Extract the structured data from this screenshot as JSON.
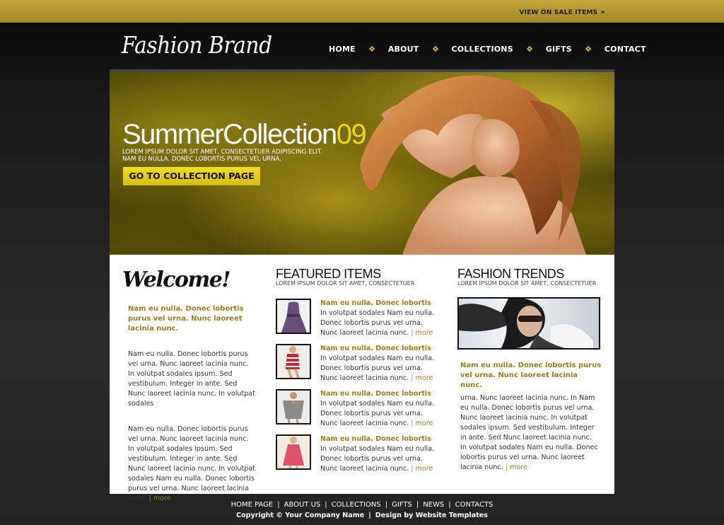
{
  "topbar": {
    "sale_label": "VIEW ON SALE ITEMS"
  },
  "header": {
    "logo": "Fashion Brand",
    "nav": [
      "HOME",
      "ABOUT",
      "COLLECTIONS",
      "GIFTS",
      "CONTACT"
    ]
  },
  "hero": {
    "title_main": "SummerCollection",
    "title_year": "09",
    "text": "LOREM IPSUM DOLOR SIT AMET, CONSECTETUER ADIPISCING ELIT. NAM EU NULLA. DONEC LOBORTIS PURUS VEL URNA.",
    "button": "GO TO COLLECTION PAGE"
  },
  "welcome": {
    "title": "Welcome!",
    "lead": "Nam eu nulla. Donec lobortis purus vel urna. Nunc laoreet lacinia nunc.",
    "para1": "Nam eu nulla. Donec lobortis purus vel urna. Nunc laoreet lacinia nunc. In volutpat sodales ipsum. Sed vestibulum. Integer in ante. Sed Nunc laoreet lacinia nunc. In volutpat sodales",
    "para2": "Nam eu nulla. Donec lobortis purus vel urna. Nunc laoreet lacinia nunc. In volutpat sodales ipsum. Sed vestibulum. Integer in ante. Sed Nunc laoreet lacinia nunc. In volutpat sodales Nam eu nulla. Donec lobortis purus vel urna. Nunc laoreet lacinia nunc.",
    "more": "more"
  },
  "featured": {
    "title": "FEATURED ITEMS",
    "subtitle": "LOREM IPSUM DOLOR SIT AMET, CONSECTETUER",
    "items": [
      {
        "title": "Nam eu nulla. Donec lobortis",
        "body": "In volutpat sodales Nam eu nulla. Donec lobortis purus vel urna. Nunc laoreet lacinia nunc.",
        "more": "more"
      },
      {
        "title": "Nam eu nulla. Donec lobortis",
        "body": "In volutpat sodales Nam eu nulla. Donec lobortis purus vel urna. Nunc laoreet lacinia nunc.",
        "more": "more"
      },
      {
        "title": "Nam eu nulla. Donec lobortis",
        "body": "In volutpat sodales Nam eu nulla. Donec lobortis purus vel urna. Nunc laoreet lacinia nunc.",
        "more": "more"
      },
      {
        "title": "Nam eu nulla. Donec lobortis",
        "body": "In volutpat sodales Nam eu nulla. Donec lobortis purus vel urna. Nunc laoreet lacinia nunc.",
        "more": "more"
      }
    ]
  },
  "trends": {
    "title": "FASHION TRENDS",
    "subtitle": "LOREM IPSUM DOLOR SIT AMET, CONSECTETUER",
    "lead": "Nam eu nulla. Donec lobortis purus vel urna. Nunc laoreet lacinia nunc.",
    "body": "urna. Nunc laoreet lacinia nunc. In Nam eu nulla. Donec lobortis purus vel urna. Nunc laoreet lacinia nunc. In volutpat sodales ipsum. Sed vestibulum. Integer in ante. Sed Nunc laoreet lacinia nunc. In volutpat sodales Nam eu nulla. Donec lobortis purus vel urna. Nunc laoreet lacinia nunc.",
    "more": "more"
  },
  "footer": {
    "links": [
      "HOME PAGE",
      "ABOUT US",
      "COLLECTIONS",
      "GIFTS",
      "NEWS",
      "CONTACTS"
    ],
    "copyright": "Copyright © Your Company Name",
    "design_by": "Design by",
    "design_link": "Website Templates"
  },
  "colors": {
    "accent_gold": "#c7a637",
    "text_gold": "#9a7d1e",
    "button_yellow": "#f3dd24",
    "dark_bg": "#1f1f1f"
  }
}
